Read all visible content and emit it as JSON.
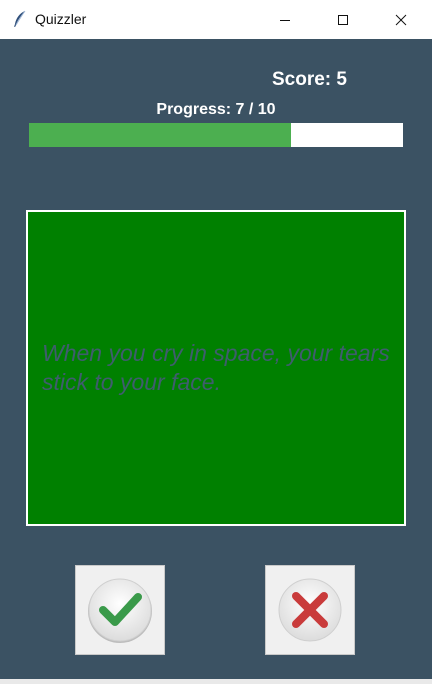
{
  "window": {
    "title": "Quizzler"
  },
  "score": {
    "label": "Score: 5",
    "value": 5
  },
  "progress": {
    "label": "Progress: 7 / 10",
    "current": 7,
    "total": 10,
    "fraction": 0.7
  },
  "question": {
    "text": "When you cry in space, your tears stick to your face."
  },
  "buttons": {
    "true_icon": "checkmark-icon",
    "false_icon": "cross-icon"
  },
  "colors": {
    "background": "#3b5263",
    "card": "#008000",
    "progress_fill": "#4caf50",
    "question_text": "#3f5d6e",
    "check": "#3a9a4a",
    "cross": "#c93b3b"
  }
}
